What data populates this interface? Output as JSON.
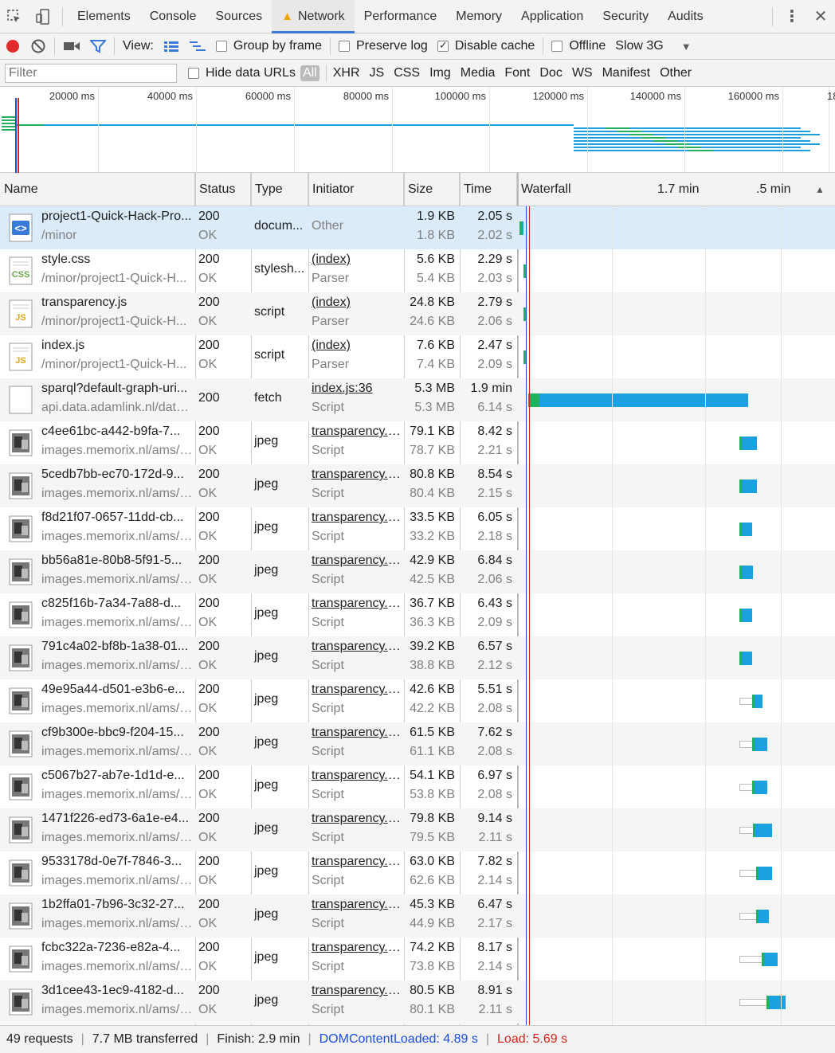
{
  "tabs": [
    "Elements",
    "Console",
    "Sources",
    "Network",
    "Performance",
    "Memory",
    "Application",
    "Security",
    "Audits"
  ],
  "toolbar": {
    "view_label": "View:",
    "group_by_frame": "Group by frame",
    "preserve_log": "Preserve log",
    "disable_cache": "Disable cache",
    "disable_cache_checked": true,
    "offline": "Offline",
    "throttle": "Slow 3G"
  },
  "filter": {
    "placeholder": "Filter",
    "hide_data_urls": "Hide data URLs",
    "types": [
      "All",
      "XHR",
      "JS",
      "CSS",
      "Img",
      "Media",
      "Font",
      "Doc",
      "WS",
      "Manifest",
      "Other"
    ]
  },
  "overview": {
    "ticks": [
      "20000 ms",
      "40000 ms",
      "60000 ms",
      "80000 ms",
      "100000 ms",
      "120000 ms",
      "140000 ms",
      "160000 ms",
      "18"
    ]
  },
  "columns": {
    "name": "Name",
    "status": "Status",
    "type": "Type",
    "initiator": "Initiator",
    "size": "Size",
    "time": "Time",
    "waterfall": "Waterfall",
    "wf_tick1": "1.7 min",
    "wf_tick2": ".5 min"
  },
  "requests": [
    {
      "name": "project1-Quick-Hack-Pro...",
      "path": "/minor",
      "status": "200",
      "status_text": "OK",
      "type": "docum...",
      "initiator": "Other",
      "initiator_detail": "",
      "size": "1.9 KB",
      "content": "1.8 KB",
      "time": "2.05 s",
      "latency": "2.02 s",
      "icon": "html-doc-icon",
      "wf_start": 0.0,
      "wf_wait": 0.006,
      "wf_recv": 0.006
    },
    {
      "name": "style.css",
      "path": "/minor/project1-Quick-H...",
      "status": "200",
      "status_text": "OK",
      "type": "stylesh...",
      "initiator": "(index)",
      "initiator_detail": "Parser",
      "size": "5.6 KB",
      "content": "5.4 KB",
      "time": "2.29 s",
      "latency": "2.03 s",
      "icon": "css-file-icon",
      "wf_start": 0.013,
      "wf_wait": 0.006,
      "wf_recv": 0.002
    },
    {
      "name": "transparency.js",
      "path": "/minor/project1-Quick-H...",
      "status": "200",
      "status_text": "OK",
      "type": "script",
      "initiator": "(index)",
      "initiator_detail": "Parser",
      "size": "24.8 KB",
      "content": "24.6 KB",
      "time": "2.79 s",
      "latency": "2.06 s",
      "icon": "js-file-icon",
      "wf_start": 0.013,
      "wf_wait": 0.006,
      "wf_recv": 0.002
    },
    {
      "name": "index.js",
      "path": "/minor/project1-Quick-H...",
      "status": "200",
      "status_text": "OK",
      "type": "script",
      "initiator": "(index)",
      "initiator_detail": "Parser",
      "size": "7.6 KB",
      "content": "7.4 KB",
      "time": "2.47 s",
      "latency": "2.09 s",
      "icon": "js-file-icon",
      "wf_start": 0.013,
      "wf_wait": 0.006,
      "wf_recv": 0.002
    },
    {
      "name": "sparql?default-graph-uri...",
      "path": "api.data.adamlink.nl/data...",
      "status": "200",
      "status_text": "",
      "type": "fetch",
      "initiator": "index.js:36",
      "initiator_detail": "Script",
      "size": "5.3 MB",
      "content": "5.3 MB",
      "time": "1.9 min",
      "latency": "6.14 s",
      "icon": "blank-file-icon",
      "wf_start": 0.028,
      "wf_wait": 0.035,
      "wf_recv": 0.67
    },
    {
      "name": "c4ee61bc-a442-b9fa-7...",
      "path": "images.memorix.nl/ams/t...",
      "status": "200",
      "status_text": "OK",
      "type": "jpeg",
      "initiator": "transparency.j...",
      "initiator_detail": "Script",
      "size": "79.1 KB",
      "content": "78.7 KB",
      "time": "8.42 s",
      "latency": "2.21 s",
      "icon": "image-thumb-icon",
      "wf_start": 0.705,
      "wf_wait": 0.008,
      "wf_recv": 0.047
    },
    {
      "name": "5cedb7bb-ec70-172d-9...",
      "path": "images.memorix.nl/ams/t...",
      "status": "200",
      "status_text": "OK",
      "type": "jpeg",
      "initiator": "transparency.j...",
      "initiator_detail": "Script",
      "size": "80.8 KB",
      "content": "80.4 KB",
      "time": "8.54 s",
      "latency": "2.15 s",
      "icon": "image-thumb-icon",
      "wf_start": 0.705,
      "wf_wait": 0.008,
      "wf_recv": 0.047
    },
    {
      "name": "f8d21f07-0657-11dd-cb...",
      "path": "images.memorix.nl/ams/t...",
      "status": "200",
      "status_text": "OK",
      "type": "jpeg",
      "initiator": "transparency.j...",
      "initiator_detail": "Script",
      "size": "33.5 KB",
      "content": "33.2 KB",
      "time": "6.05 s",
      "latency": "2.18 s",
      "icon": "image-thumb-icon",
      "wf_start": 0.705,
      "wf_wait": 0.008,
      "wf_recv": 0.031
    },
    {
      "name": "bb56a81e-80b8-5f91-5...",
      "path": "images.memorix.nl/ams/t...",
      "status": "200",
      "status_text": "OK",
      "type": "jpeg",
      "initiator": "transparency.j...",
      "initiator_detail": "Script",
      "size": "42.9 KB",
      "content": "42.5 KB",
      "time": "6.84 s",
      "latency": "2.06 s",
      "icon": "image-thumb-icon",
      "wf_start": 0.705,
      "wf_wait": 0.008,
      "wf_recv": 0.035
    },
    {
      "name": "c825f16b-7a34-7a88-d...",
      "path": "images.memorix.nl/ams/t...",
      "status": "200",
      "status_text": "OK",
      "type": "jpeg",
      "initiator": "transparency.j...",
      "initiator_detail": "Script",
      "size": "36.7 KB",
      "content": "36.3 KB",
      "time": "6.43 s",
      "latency": "2.09 s",
      "icon": "image-thumb-icon",
      "wf_start": 0.705,
      "wf_wait": 0.008,
      "wf_recv": 0.031
    },
    {
      "name": "791c4a02-bf8b-1a38-01...",
      "path": "images.memorix.nl/ams/t...",
      "status": "200",
      "status_text": "OK",
      "type": "jpeg",
      "initiator": "transparency.j...",
      "initiator_detail": "Script",
      "size": "39.2 KB",
      "content": "38.8 KB",
      "time": "6.57 s",
      "latency": "2.12 s",
      "icon": "image-thumb-icon",
      "wf_start": 0.705,
      "wf_wait": 0.008,
      "wf_recv": 0.031
    },
    {
      "name": "49e95a44-d501-e3b6-e...",
      "path": "images.memorix.nl/ams/t...",
      "status": "200",
      "status_text": "OK",
      "type": "jpeg",
      "initiator": "transparency.j...",
      "initiator_detail": "Script",
      "size": "42.6 KB",
      "content": "42.2 KB",
      "time": "5.51 s",
      "latency": "2.08 s",
      "icon": "image-thumb-icon",
      "wf_start": 0.705,
      "wf_queue": 0.04,
      "wf_wait": 0.004,
      "wf_recv": 0.026
    },
    {
      "name": "cf9b300e-bbc9-f204-15...",
      "path": "images.memorix.nl/ams/t...",
      "status": "200",
      "status_text": "OK",
      "type": "jpeg",
      "initiator": "transparency.j...",
      "initiator_detail": "Script",
      "size": "61.5 KB",
      "content": "61.1 KB",
      "time": "7.62 s",
      "latency": "2.08 s",
      "icon": "image-thumb-icon",
      "wf_start": 0.705,
      "wf_queue": 0.04,
      "wf_wait": 0.004,
      "wf_recv": 0.041
    },
    {
      "name": "c5067b27-ab7e-1d1d-e...",
      "path": "images.memorix.nl/ams/t...",
      "status": "200",
      "status_text": "OK",
      "type": "jpeg",
      "initiator": "transparency.j...",
      "initiator_detail": "Script",
      "size": "54.1 KB",
      "content": "53.8 KB",
      "time": "6.97 s",
      "latency": "2.08 s",
      "icon": "image-thumb-icon",
      "wf_start": 0.705,
      "wf_queue": 0.04,
      "wf_wait": 0.004,
      "wf_recv": 0.041
    },
    {
      "name": "1471f226-ed73-6a1e-e4...",
      "path": "images.memorix.nl/ams/t...",
      "status": "200",
      "status_text": "OK",
      "type": "jpeg",
      "initiator": "transparency.j...",
      "initiator_detail": "Script",
      "size": "79.8 KB",
      "content": "79.5 KB",
      "time": "9.14 s",
      "latency": "2.11 s",
      "icon": "image-thumb-icon",
      "wf_start": 0.705,
      "wf_queue": 0.043,
      "wf_wait": 0.004,
      "wf_recv": 0.052
    },
    {
      "name": "9533178d-0e7f-7846-3...",
      "path": "images.memorix.nl/ams/t...",
      "status": "200",
      "status_text": "OK",
      "type": "jpeg",
      "initiator": "transparency.j...",
      "initiator_detail": "Script",
      "size": "63.0 KB",
      "content": "62.6 KB",
      "time": "7.82 s",
      "latency": "2.14 s",
      "icon": "image-thumb-icon",
      "wf_start": 0.705,
      "wf_queue": 0.052,
      "wf_wait": 0.004,
      "wf_recv": 0.043
    },
    {
      "name": "1b2ffa01-7b96-3c32-27...",
      "path": "images.memorix.nl/ams/t...",
      "status": "200",
      "status_text": "OK",
      "type": "jpeg",
      "initiator": "transparency.j...",
      "initiator_detail": "Script",
      "size": "45.3 KB",
      "content": "44.9 KB",
      "time": "6.47 s",
      "latency": "2.17 s",
      "icon": "image-thumb-icon",
      "wf_start": 0.705,
      "wf_queue": 0.052,
      "wf_wait": 0.004,
      "wf_recv": 0.035
    },
    {
      "name": "fcbc322a-7236-e82a-4...",
      "path": "images.memorix.nl/ams/t...",
      "status": "200",
      "status_text": "OK",
      "type": "jpeg",
      "initiator": "transparency.j...",
      "initiator_detail": "Script",
      "size": "74.2 KB",
      "content": "73.8 KB",
      "time": "8.17 s",
      "latency": "2.14 s",
      "icon": "image-thumb-icon",
      "wf_start": 0.705,
      "wf_queue": 0.07,
      "wf_wait": 0.004,
      "wf_recv": 0.043
    },
    {
      "name": "3d1cee43-1ec9-4182-d...",
      "path": "images.memorix.nl/ams/t...",
      "status": "200",
      "status_text": "OK",
      "type": "jpeg",
      "initiator": "transparency.j...",
      "initiator_detail": "Script",
      "size": "80.5 KB",
      "content": "80.1 KB",
      "time": "8.91 s",
      "latency": "2.11 s",
      "icon": "image-thumb-icon",
      "wf_start": 0.705,
      "wf_queue": 0.087,
      "wf_wait": 0.004,
      "wf_recv": 0.052
    }
  ],
  "status": {
    "requests": "49 requests",
    "transferred": "7.7 MB transferred",
    "finish": "Finish: 2.9 min",
    "dom_content_loaded": "DOMContentLoaded: 4.89 s",
    "load": "Load: 5.69 s"
  },
  "colors": {
    "accent": "#3879d9",
    "waiting": "#21b05e",
    "receiving": "#1ba1e2",
    "dcl_line": "#1a4ee4",
    "load_line": "#d9241b"
  }
}
